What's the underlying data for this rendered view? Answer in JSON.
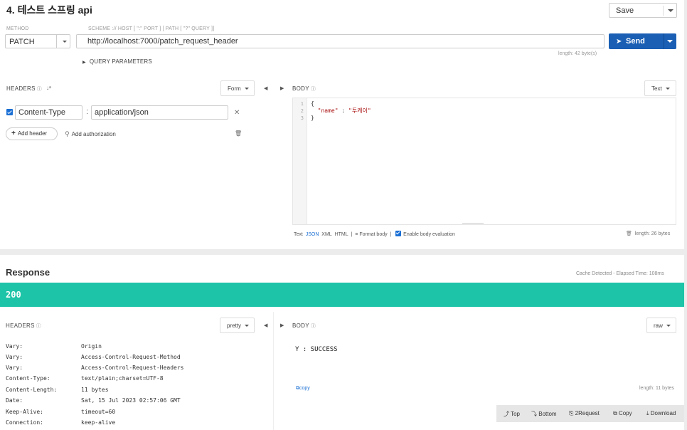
{
  "request": {
    "title": "4. 테스트 스프링 api",
    "save_label": "Save",
    "method_label": "METHOD",
    "scheme_label": "SCHEME :// HOST [ \":\" PORT ] [ PATH [ \"?\" QUERY ]]",
    "method": "PATCH",
    "url": "http://localhost:7000/patch_request_header",
    "send_label": "Send",
    "url_length": "length: 42 byte(s)",
    "query_params_label": "QUERY PARAMETERS",
    "headers": {
      "title": "HEADERS",
      "mode": "Form",
      "items": [
        {
          "key": "Content-Type",
          "value": "application/json",
          "enabled": true
        }
      ],
      "add_header_label": "Add header",
      "add_auth_label": "Add authorization"
    },
    "body": {
      "title": "BODY",
      "mode": "Text",
      "line_numbers": [
        "1",
        "2",
        "3"
      ],
      "line1": "{",
      "key": "\"name\"",
      "sep": " : ",
      "value": "\"투케이\"",
      "line3": "}",
      "format_text": "Text",
      "format_json": "JSON",
      "format_xml": "XML",
      "format_html": "HTML",
      "format_body_label": "Format body",
      "eval_label": "Enable body evaluation",
      "length": "length: 26 bytes"
    }
  },
  "response": {
    "title": "Response",
    "cache_info": "Cache Detected - Elapsed Time: 108ms",
    "status": "200",
    "headers_title": "HEADERS",
    "headers_mode": "pretty",
    "headers": [
      {
        "key": "Vary:",
        "value": "Origin"
      },
      {
        "key": "Vary:",
        "value": "Access-Control-Request-Method"
      },
      {
        "key": "Vary:",
        "value": "Access-Control-Request-Headers"
      },
      {
        "key": "Content-Type:",
        "value": "text/plain;charset=UTF-8"
      },
      {
        "key": "Content-Length:",
        "value": "11 bytes"
      },
      {
        "key": "Date:",
        "value": "Sat, 15 Jul 2023 02:57:06 GMT"
      },
      {
        "key": "Keep-Alive:",
        "value": "timeout=60"
      },
      {
        "key": "Connection:",
        "value": "keep-alive"
      }
    ],
    "body_title": "BODY",
    "body_mode": "raw",
    "body_text": "Y : SUCCESS",
    "copy_label": "copy",
    "length": "length: 11 bytes",
    "toolbar": {
      "top": "Top",
      "bottom": "Bottom",
      "request": "2Request",
      "copy": "Copy",
      "download": "Download"
    }
  }
}
